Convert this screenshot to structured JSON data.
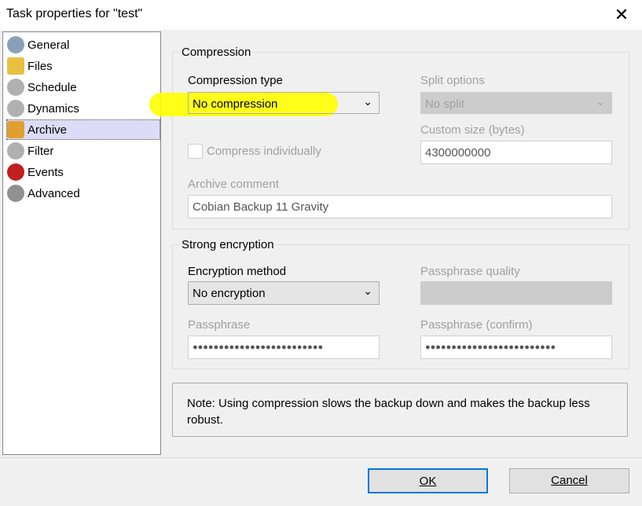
{
  "window": {
    "title": "Task properties for \"test\"",
    "close": "✕"
  },
  "nav": {
    "items": [
      {
        "label": "General",
        "icon": "user-icon",
        "color": "#8aa0b8"
      },
      {
        "label": "Files",
        "icon": "folder-check-icon",
        "color": "#e8c040"
      },
      {
        "label": "Schedule",
        "icon": "clock-icon",
        "color": "#b0b0b0"
      },
      {
        "label": "Dynamics",
        "icon": "refresh-icon",
        "color": "#b0b0b0"
      },
      {
        "label": "Archive",
        "icon": "folder-icon",
        "color": "#e0a030"
      },
      {
        "label": "Filter",
        "icon": "minus-icon",
        "color": "#b0b0b0"
      },
      {
        "label": "Events",
        "icon": "magnet-icon",
        "color": "#c02020"
      },
      {
        "label": "Advanced",
        "icon": "gear-icon",
        "color": "#909090"
      }
    ],
    "selected": "Archive"
  },
  "compression": {
    "group": "Compression",
    "type_label": "Compression type",
    "type_value": "No compression",
    "split_label": "Split options",
    "split_value": "No split",
    "custom_label": "Custom size (bytes)",
    "custom_value": "4300000000",
    "individually": "Compress individually",
    "comment_label": "Archive comment",
    "comment_value": "Cobian Backup 11 Gravity"
  },
  "encryption": {
    "group": "Strong encryption",
    "method_label": "Encryption method",
    "method_value": "No encryption",
    "quality_label": "Passphrase quality",
    "pass_label": "Passphrase",
    "pass_value": "●●●●●●●●●●●●●●●●●●●●●●●●●",
    "confirm_label": "Passphrase (confirm)",
    "confirm_value": "●●●●●●●●●●●●●●●●●●●●●●●●●"
  },
  "note": "Note: Using compression slows the backup down and makes the backup less robust.",
  "buttons": {
    "ok": "OK",
    "cancel": "Cancel"
  },
  "highlight_color": "#ffff00"
}
